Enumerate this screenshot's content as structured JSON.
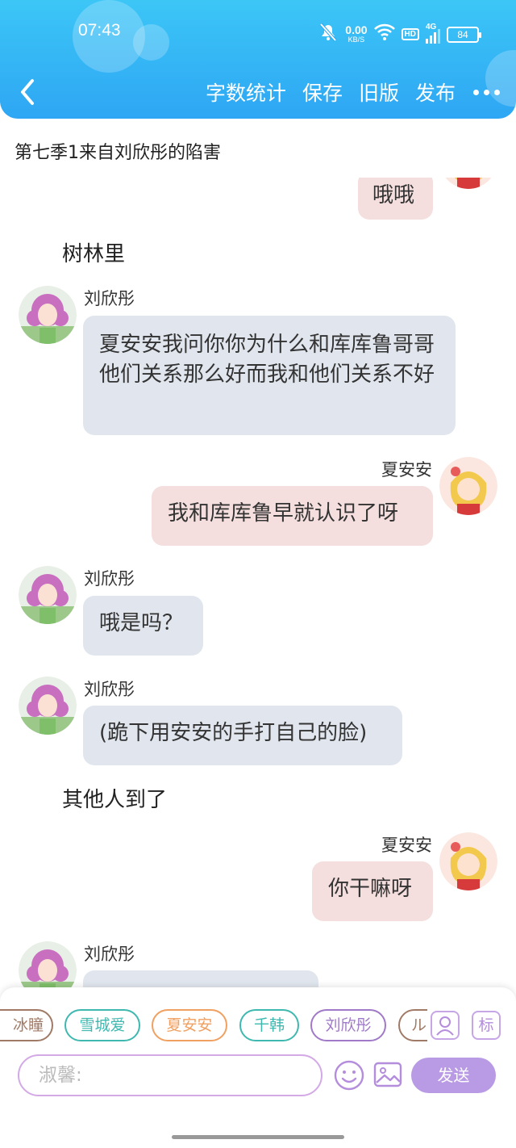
{
  "status_bar": {
    "time": "07:43",
    "net_speed": "0.00",
    "net_unit": "KB/S",
    "hd": "HD",
    "signal": "4G",
    "battery": "84"
  },
  "toolbar": {
    "back_icon": "chevron-left-icon",
    "actions": [
      "字数统计",
      "保存",
      "旧版",
      "发布"
    ],
    "more_icon": "more-dots-icon"
  },
  "chapter_title": "第七季1来自刘欣彤的陷害",
  "chat": [
    {
      "type": "message",
      "side": "right",
      "text": "哦哦"
    },
    {
      "type": "narration",
      "text": "树林里"
    },
    {
      "type": "message",
      "side": "left",
      "speaker": "刘欣彤",
      "text": "夏安安我问你你为什么和库库鲁哥哥他们关系那么好而我和他们关系不好"
    },
    {
      "type": "message",
      "side": "right",
      "speaker": "夏安安",
      "text": "我和库库鲁早就认识了呀"
    },
    {
      "type": "message",
      "side": "left",
      "speaker": "刘欣彤",
      "text": "哦是吗？"
    },
    {
      "type": "message",
      "side": "left",
      "speaker": "刘欣彤",
      "text": "(跪下用安安的手打自己的脸)"
    },
    {
      "type": "narration",
      "text": "其他人到了"
    },
    {
      "type": "message",
      "side": "right",
      "speaker": "夏安安",
      "text": "你干嘛呀"
    },
    {
      "type": "message",
      "side": "left",
      "speaker": "刘欣彤",
      "text": ""
    }
  ],
  "composer": {
    "characters": [
      "冰瞳",
      "雪城爱",
      "夏安安",
      "千韩",
      "刘欣彤",
      "ル"
    ],
    "character_colors": [
      "#a07a66",
      "#3fb8b0",
      "#f0a060",
      "#3fb8b0",
      "#a07ac8",
      "#a07a66"
    ],
    "tool_icons": [
      "person-card-icon",
      "tag-icon"
    ],
    "tag_label": "标",
    "input_placeholder": "淑馨:",
    "emoji_icon": "smiley-icon",
    "image_icon": "image-icon",
    "send_label": "发送"
  }
}
